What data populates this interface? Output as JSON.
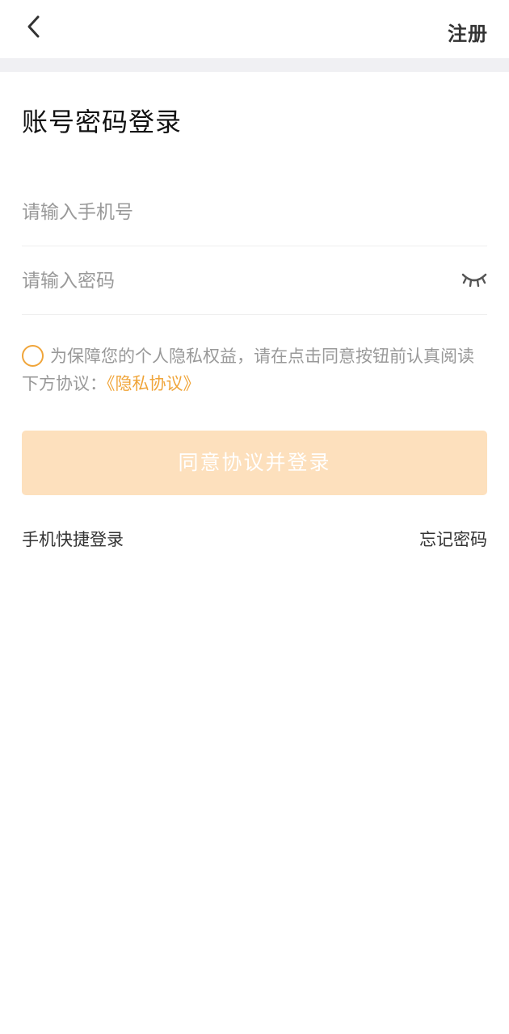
{
  "header": {
    "back_icon": "chevron-left-icon",
    "register_label": "注册"
  },
  "title": "账号密码登录",
  "form": {
    "phone_placeholder": "请输入手机号",
    "password_placeholder": "请输入密码",
    "password_toggle_icon": "eye-closed-icon"
  },
  "agreement": {
    "checked": false,
    "text": "为保障您的个人隐私权益，请在点击同意按钮前认真阅读下方协议：",
    "link_label": "《隐私协议》"
  },
  "login_button": {
    "label": "同意协议并登录"
  },
  "links": {
    "quick_login_label": "手机快捷登录",
    "forgot_password_label": "忘记密码"
  },
  "colors": {
    "accent": "#f0a53a",
    "button_disabled_bg": "#fde0bd",
    "divider_band": "#f0f0f3"
  }
}
